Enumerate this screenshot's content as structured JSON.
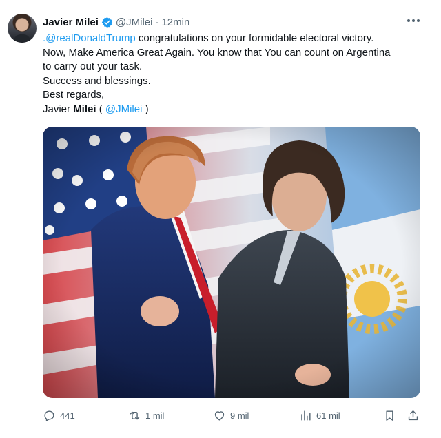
{
  "tweet": {
    "author_name": "Javier Milei",
    "handle": "@JMilei",
    "separator": "·",
    "time": "12min",
    "text_lines": [
      {
        "mention": ".@realDonaldTrump",
        "rest": " congratulations on your formidable electoral victory."
      },
      "Now, Make America Great Again. You know that You can count on Argentina",
      "to carry out your task.",
      "Success and blessings.",
      "Best regards,"
    ],
    "signature": {
      "first": "Javier ",
      "last": "Milei",
      "open": " ( ",
      "mention": "@JMilei",
      "close": " )"
    }
  },
  "icons": {
    "verified": "verified-badge-icon",
    "more": "more-options-icon",
    "reply": "reply-icon",
    "retweet": "retweet-icon",
    "like": "like-icon",
    "views": "views-icon",
    "bookmark": "bookmark-icon",
    "share": "share-icon"
  },
  "actions": {
    "replies": "441",
    "retweets": "1 mil",
    "likes": "9 mil",
    "views": "61 mil"
  },
  "colors": {
    "text": "#0f1419",
    "secondary": "#536471",
    "link": "#1d9bf0",
    "verified": "#1d9bf0"
  }
}
